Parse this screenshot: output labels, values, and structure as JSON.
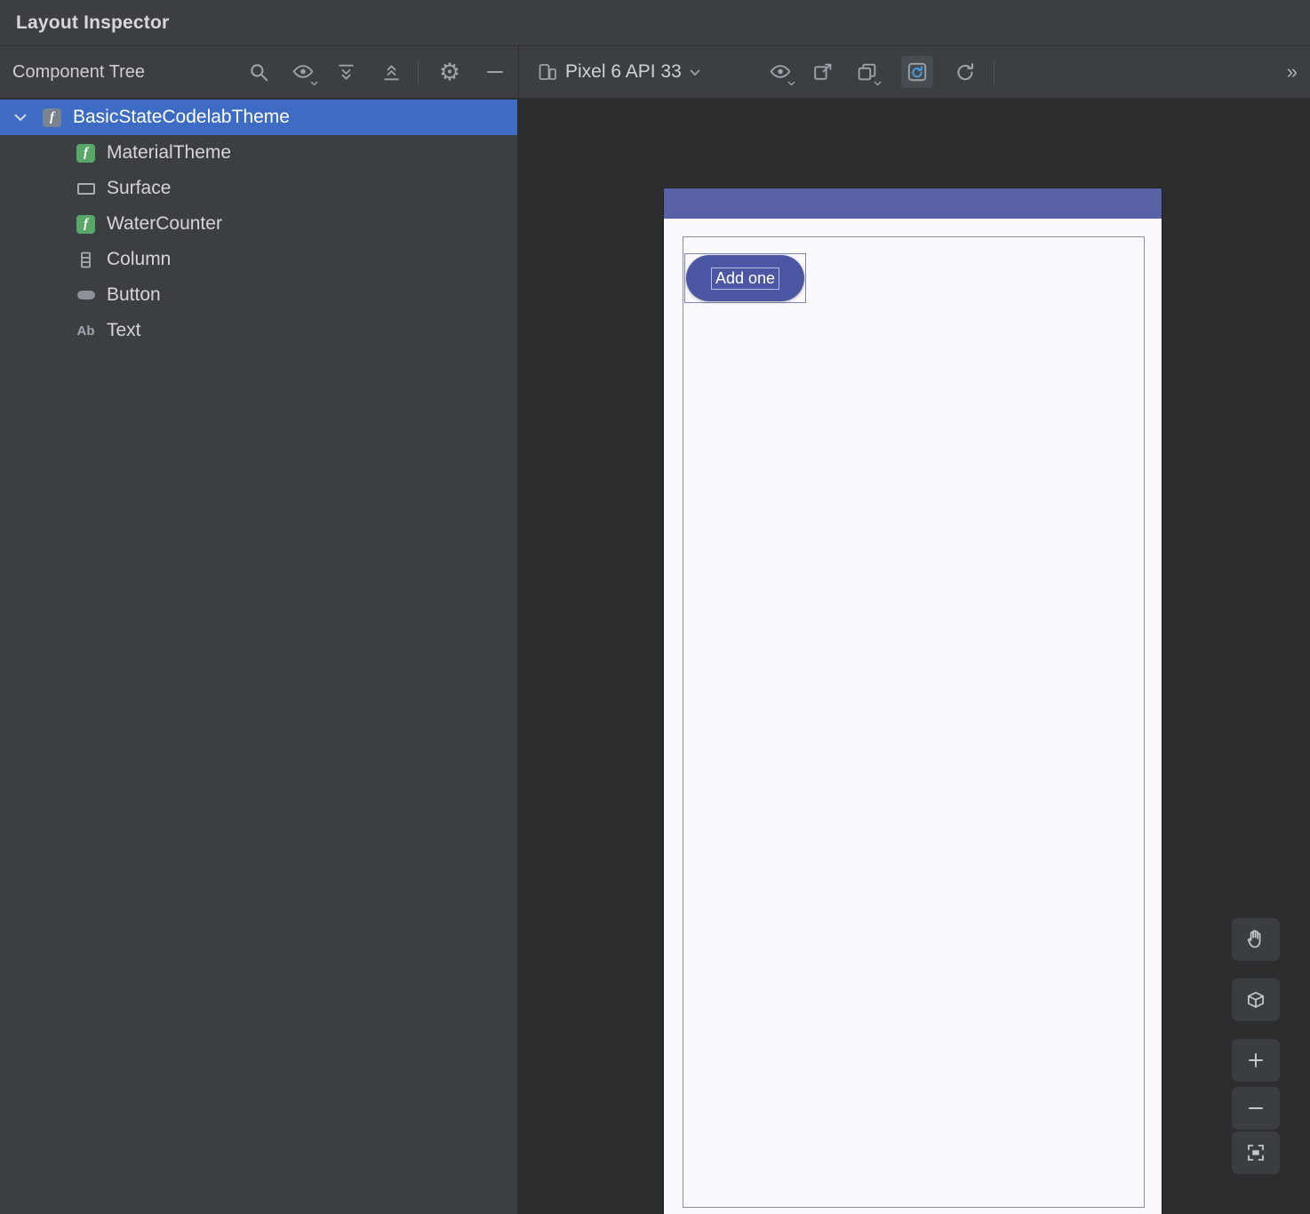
{
  "window": {
    "title": "Layout Inspector"
  },
  "toolbar": {
    "panel_title": "Component Tree",
    "device_selector": {
      "label": "Pixel 6 API 33"
    },
    "overflow_label": "»",
    "icons": [
      "search",
      "visibility",
      "expand-all",
      "collapse-all",
      "settings",
      "hide-panel",
      "device-picker",
      "render-options",
      "export-screenshot",
      "export-snapshot",
      "live-updates",
      "refresh"
    ]
  },
  "glyphs": {
    "gear": "⚙",
    "compose": "f",
    "text_node": "Ab"
  },
  "component_tree": {
    "items": [
      {
        "label": "BasicStateCodelabTheme",
        "icon": "compose-node",
        "level": 0,
        "selected": true,
        "expanded": true
      },
      {
        "label": "MaterialTheme",
        "icon": "compose-node",
        "level": 1
      },
      {
        "label": "Surface",
        "icon": "surface-node",
        "level": 1
      },
      {
        "label": "WaterCounter",
        "icon": "compose-node",
        "level": 1
      },
      {
        "label": "Column",
        "icon": "column-node",
        "level": 1
      },
      {
        "label": "Button",
        "icon": "button-node",
        "level": 1
      },
      {
        "label": "Text",
        "icon": "text-node",
        "level": 1
      }
    ]
  },
  "device_screen": {
    "device": "Pixel 6 API 33",
    "button_label": "Add one",
    "colors": {
      "app_bar": "#5961a6",
      "screen": "#fcf9fe",
      "button": "#4b57a3",
      "component_border": "#8d8d92",
      "selection_border": "#7c86b8"
    }
  },
  "canvas_controls": [
    "pan",
    "3d-mode",
    "zoom-in",
    "zoom-out",
    "zoom-to-fit"
  ],
  "colors": {
    "titlebar": "#3d4043",
    "toolbar": "#3c3f41",
    "tree_panel": "#3c3f41",
    "canvas": "#2b2d2f",
    "tree_selection": "#3e6cc4",
    "live_updates_accent": "#4aa0e8"
  }
}
